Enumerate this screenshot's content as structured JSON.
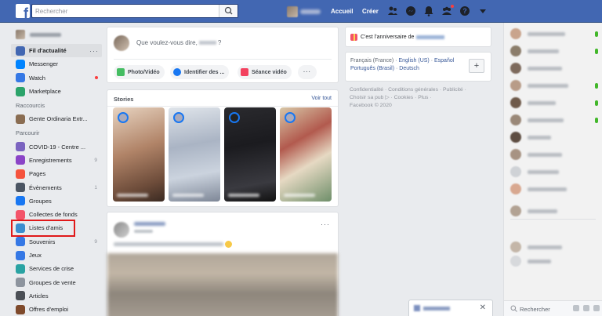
{
  "topbar": {
    "search_placeholder": "Rechercher",
    "home_label": "Accueil",
    "create_label": "Créer"
  },
  "sidebar": {
    "items": [
      {
        "label": "Fil d'actualité",
        "icon": "news-feed-icon",
        "color": "#4267b2"
      },
      {
        "label": "Messenger",
        "icon": "messenger-icon",
        "color": "#0084ff"
      },
      {
        "label": "Watch",
        "icon": "watch-icon",
        "color": "#3578e5"
      },
      {
        "label": "Marketplace",
        "icon": "marketplace-icon",
        "color": "#2ba36a"
      }
    ],
    "shortcuts_heading": "Raccourcis",
    "shortcuts": [
      {
        "label": "Gente Ordinaria Extr...",
        "icon": "group-avatar-icon",
        "color": "#8a6d52"
      }
    ],
    "explore_heading": "Parcourir",
    "explore": [
      {
        "label": "COVID-19 - Centre ...",
        "icon": "covid-shield-icon",
        "color": "#7b64c0",
        "count": ""
      },
      {
        "label": "Enregistrements",
        "icon": "bookmark-icon",
        "color": "#8b44c7",
        "count": "9"
      },
      {
        "label": "Pages",
        "icon": "flag-icon",
        "color": "#f5533d",
        "count": ""
      },
      {
        "label": "Évènements",
        "icon": "calendar-icon",
        "color": "#4b5563",
        "count": "1"
      },
      {
        "label": "Groupes",
        "icon": "groups-icon",
        "color": "#1877f2",
        "count": ""
      },
      {
        "label": "Collectes de fonds",
        "icon": "heart-fundraiser-icon",
        "color": "#f35369",
        "count": ""
      },
      {
        "label": "Listes d'amis",
        "icon": "friend-lists-icon",
        "color": "#3b8dcf",
        "count": ""
      },
      {
        "label": "Souvenirs",
        "icon": "memories-icon",
        "color": "#3578e5",
        "count": "9"
      },
      {
        "label": "Jeux",
        "icon": "games-icon",
        "color": "#3578e5",
        "count": ""
      },
      {
        "label": "Services de crise",
        "icon": "crisis-response-icon",
        "color": "#2aa3a3",
        "count": ""
      },
      {
        "label": "Groupes de vente",
        "icon": "sale-groups-icon",
        "color": "#8d949e",
        "count": ""
      },
      {
        "label": "Articles",
        "icon": "articles-icon",
        "color": "#4b4f56",
        "count": ""
      },
      {
        "label": "Offres d'emploi",
        "icon": "jobs-icon",
        "color": "#7f4a2c",
        "count": ""
      }
    ]
  },
  "composer": {
    "prompt_start": "Que voulez-vous dire,",
    "prompt_end": "?",
    "actions": [
      {
        "label": "Photo/Vidéo",
        "icon": "photo-icon",
        "color": "#45bd62"
      },
      {
        "label": "Identifier des ...",
        "icon": "tag-friends-icon",
        "color": "#1877f2"
      },
      {
        "label": "Séance vidéo",
        "icon": "video-room-icon",
        "color": "#f3425f"
      }
    ]
  },
  "stories": {
    "heading": "Stories",
    "see_all": "Voir tout"
  },
  "right": {
    "birthday_text": "C'est l'anniversaire de",
    "lang_line1_a": "Français (France)",
    "lang_sep": " · ",
    "lang_line1_b": "English (US)",
    "lang_line1_c": "Español",
    "lang_line2_a": "Português (Brasil)",
    "lang_line2_b": "Deutsch",
    "footer_line1": "Confidentialité · Conditions générales · Publicité ·",
    "footer_line2": "Choisir sa pub ▷ · Cookies · Plus ·",
    "footer_line3": "Facebook © 2020"
  },
  "chat": {
    "search_label": "Rechercher"
  },
  "colors": {
    "brand": "#4267b2",
    "highlight": "#e0191a",
    "online": "#42b72a"
  }
}
